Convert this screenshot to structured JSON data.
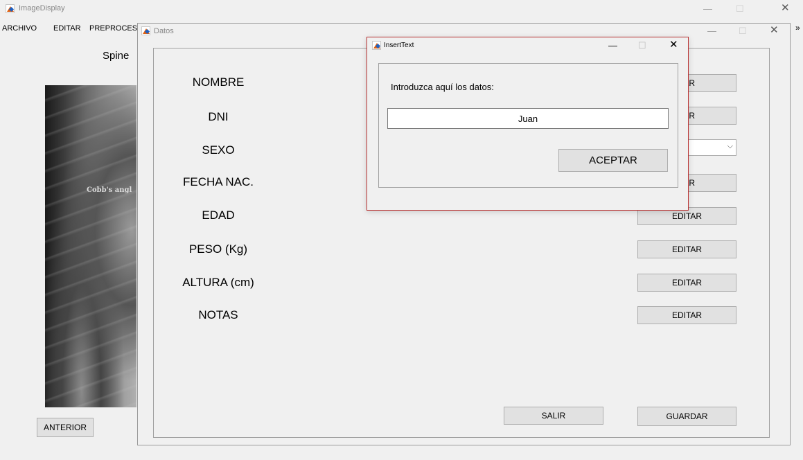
{
  "main_window": {
    "title": "ImageDisplay",
    "menu": [
      "ARCHIVO",
      "EDITAR",
      "PREPROCESA"
    ],
    "image_title": "Spine",
    "image_overlay_text": "Cobb's angl",
    "prev_button": "ANTERIOR",
    "ctrl_min": "—",
    "ctrl_max": "☐",
    "ctrl_close": "✕",
    "edge_glyph": "»"
  },
  "datos_window": {
    "title": "Datos",
    "ctrl_min": "—",
    "ctrl_max": "☐",
    "ctrl_close": "✕",
    "fields": [
      "NOMBRE",
      "DNI",
      "SEXO",
      "FECHA NAC.",
      "EDAD",
      "PESO (Kg)",
      "ALTURA (cm)",
      "NOTAS"
    ],
    "edit_buttons": [
      "TAR",
      "TAR",
      "TAR",
      "EDITAR",
      "EDITAR",
      "EDITAR",
      "EDITAR"
    ],
    "salir": "SALIR",
    "guardar": "GUARDAR"
  },
  "insert_dialog": {
    "title": "InsertText",
    "prompt": "Introduzca aquí los datos:",
    "input_value": "Juan",
    "accept": "ACEPTAR",
    "ctrl_min": "—",
    "ctrl_max": "☐",
    "ctrl_close": "✕"
  },
  "colors": {
    "dialog_border": "#b83030",
    "background": "#f0f0f0",
    "button": "#e1e1e1"
  }
}
